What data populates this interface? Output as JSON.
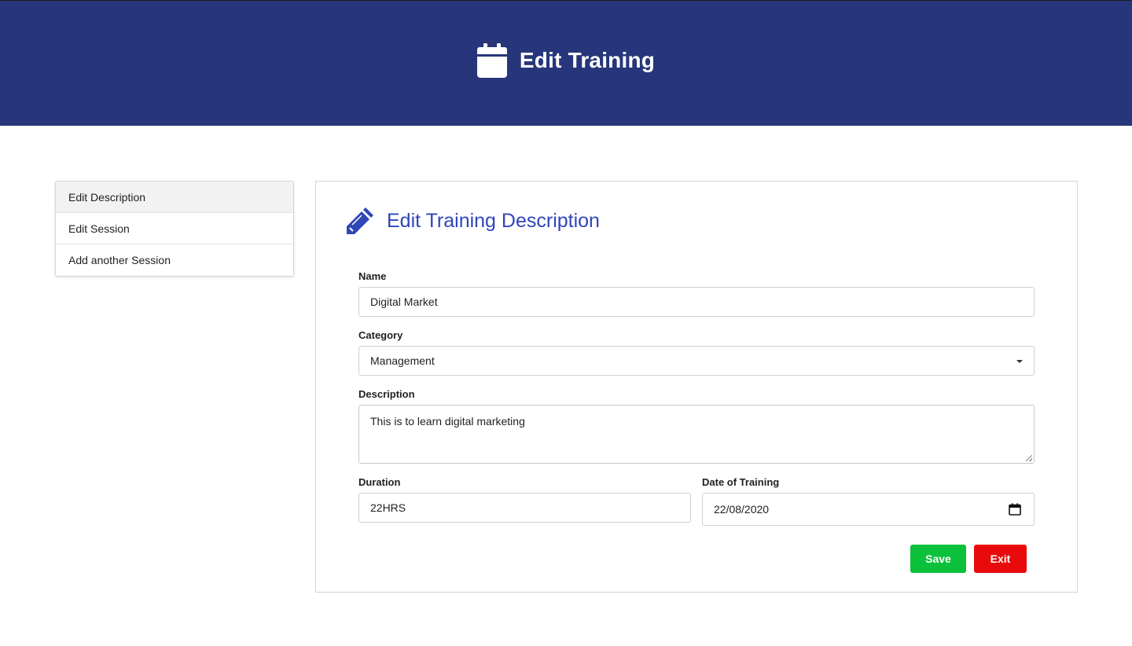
{
  "header": {
    "title": "Edit Training",
    "icon": "calendar-icon",
    "background": "#27367a"
  },
  "sidebar": {
    "items": [
      {
        "label": "Edit Description",
        "active": true
      },
      {
        "label": "Edit Session",
        "active": false
      },
      {
        "label": "Add another Session",
        "active": false
      }
    ]
  },
  "card": {
    "title": "Edit Training Description",
    "icon": "pencil-icon",
    "title_color": "#2f46b8"
  },
  "form": {
    "name_label": "Name",
    "name_value": "Digital Market",
    "category_label": "Category",
    "category_value": "Management",
    "description_label": "Description",
    "description_value": "This is to learn digital marketing",
    "duration_label": "Duration",
    "duration_value": "22HRS",
    "date_label": "Date of Training",
    "date_value": "22/08/2020"
  },
  "actions": {
    "save_label": "Save",
    "save_color": "#0bc03a",
    "exit_label": "Exit",
    "exit_color": "#e90b0b"
  }
}
